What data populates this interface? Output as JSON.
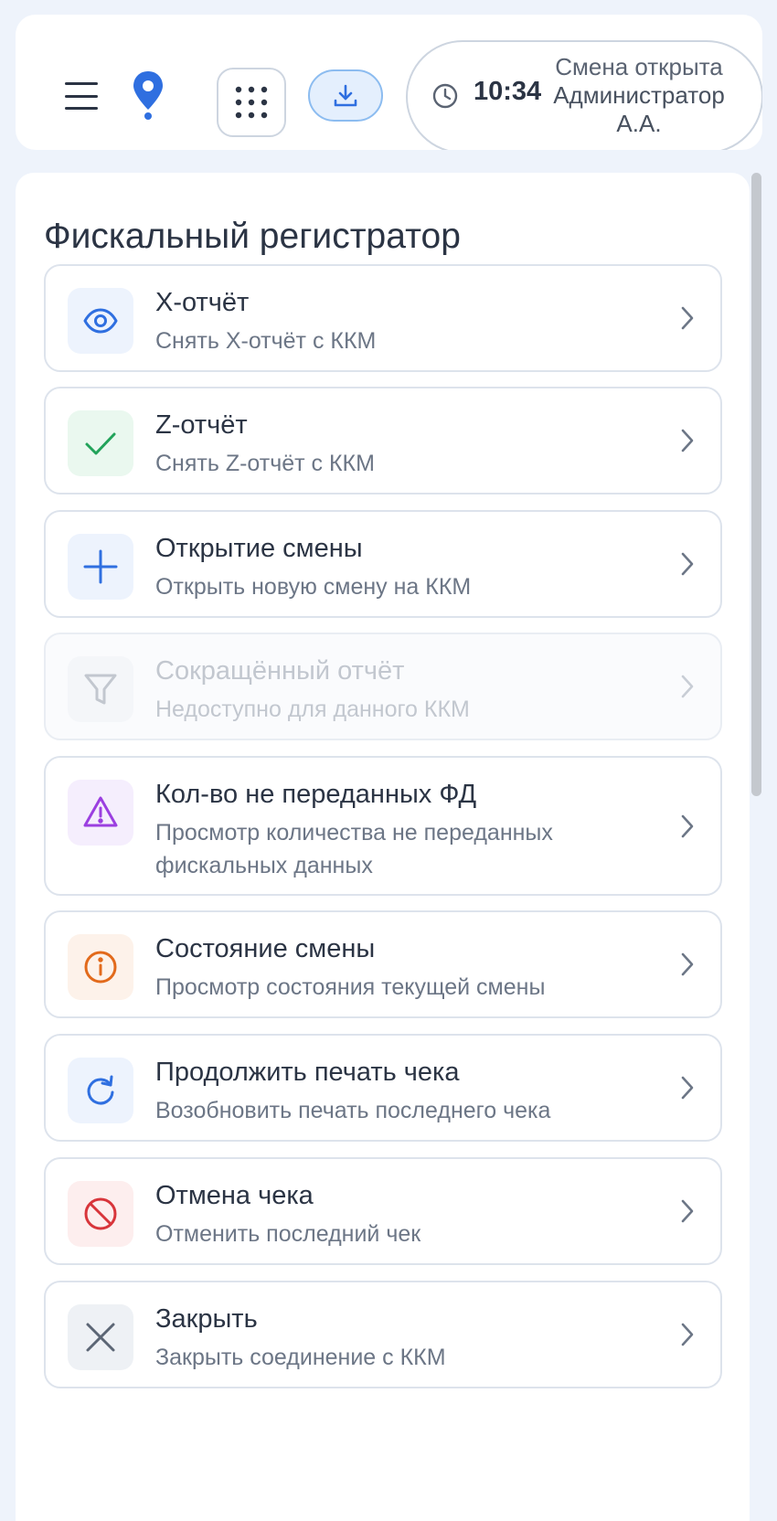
{
  "header": {
    "time": "10:34",
    "session_status": "Смена открыта",
    "operator": "Администратор А.А."
  },
  "page_title": "Фискальный регистратор",
  "menu": [
    {
      "title": "X-отчёт",
      "subtitle": "Снять X-отчёт с ККМ",
      "icon": "eye-icon",
      "color": "#2f6fe0",
      "bg": "#edf3fd",
      "enabled": true
    },
    {
      "title": "Z-отчёт",
      "subtitle": "Снять Z-отчёт с ККМ",
      "icon": "check-icon",
      "color": "#22a35a",
      "bg": "#eaf8ef",
      "enabled": true
    },
    {
      "title": "Открытие смены",
      "subtitle": "Открыть новую смену на ККМ",
      "icon": "plus-icon",
      "color": "#2f6fe0",
      "bg": "#edf3fd",
      "enabled": true
    },
    {
      "title": "Сокращённый отчёт",
      "subtitle": "Недоступно для данного ККМ",
      "icon": "filter-icon",
      "color": "#c2c7cf",
      "bg": "#f4f6f9",
      "enabled": false
    },
    {
      "title": "Кол-во не переданных ФД",
      "subtitle": "Просмотр количества не переданных фискальных данных",
      "icon": "warning-icon",
      "color": "#9b3fe0",
      "bg": "#f5eefd",
      "enabled": true
    },
    {
      "title": "Состояние смены",
      "subtitle": "Просмотр состояния текущей смены",
      "icon": "info-icon",
      "color": "#e26a1b",
      "bg": "#fdf2ea",
      "enabled": true
    },
    {
      "title": "Продолжить печать чека",
      "subtitle": "Возобновить печать последнего чека",
      "icon": "refresh-icon",
      "color": "#2f6fe0",
      "bg": "#edf3fd",
      "enabled": true
    },
    {
      "title": "Отмена чека",
      "subtitle": "Отменить последний чек",
      "icon": "cancel-icon",
      "color": "#d8353b",
      "bg": "#fdeeee",
      "enabled": true
    },
    {
      "title": "Закрыть",
      "subtitle": "Закрыть соединение с ККМ",
      "icon": "close-icon",
      "color": "#5c6675",
      "bg": "#eef1f5",
      "enabled": true
    }
  ]
}
